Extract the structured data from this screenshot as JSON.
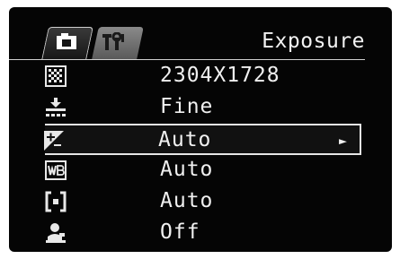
{
  "menu": {
    "title": "Exposure",
    "tabs": [
      {
        "icon": "camera-icon",
        "active": true
      },
      {
        "icon": "setup-tools-icon",
        "active": false
      }
    ],
    "rows": [
      {
        "icon": "image-size-icon",
        "value": "2304X1728",
        "selected": false
      },
      {
        "icon": "quality-icon",
        "value": "Fine",
        "selected": false
      },
      {
        "icon": "exposure-compensation-icon",
        "value": "Auto",
        "selected": true
      },
      {
        "icon": "white-balance-icon",
        "value": "Auto",
        "selected": false
      },
      {
        "icon": "metering-icon",
        "value": "Auto",
        "selected": false
      },
      {
        "icon": "iso-sensitivity-icon",
        "value": "Off",
        "selected": false
      }
    ],
    "submenu_arrow": "►"
  },
  "colors": {
    "background": "#050505",
    "text": "#f0f0f0",
    "active_tab": "#2a2a2a",
    "inactive_tab": "#7a7a7a"
  }
}
